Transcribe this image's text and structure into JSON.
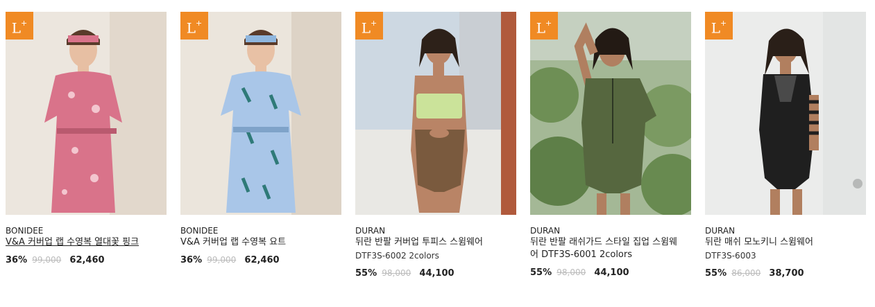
{
  "products": [
    {
      "badge": "L",
      "badge_sup": "+",
      "brand": "BONIDEE",
      "name": "V&A 커버업 랩 수영복 열대꽃 핑크",
      "code": "",
      "discount": "36%",
      "original_price": "99,000",
      "sale_price": "62,460",
      "outfit_color": "#d9738a",
      "bg_color": "#e8e1d8"
    },
    {
      "badge": "L",
      "badge_sup": "+",
      "brand": "BONIDEE",
      "name": "V&A 커버업 랩 수영복 요트",
      "code": "",
      "discount": "36%",
      "original_price": "99,000",
      "sale_price": "62,460",
      "outfit_color": "#8fb6de",
      "bg_color": "#e7e0d6"
    },
    {
      "badge": "L",
      "badge_sup": "+",
      "brand": "DURAN",
      "name": "뒤란 반팔 커버업 투피스 스윔웨어",
      "code": "DTF3S-6002 2colors",
      "discount": "55%",
      "original_price": "98,000",
      "sale_price": "44,100",
      "outfit_color": "#7a5a3e",
      "bg_color": "#cfd9e3"
    },
    {
      "badge": "L",
      "badge_sup": "+",
      "brand": "DURAN",
      "name": "뒤란 반팔 래쉬가드 스타일 집업 스윔웨어 DTF3S-6001 2colors",
      "code": "",
      "discount": "55%",
      "original_price": "98,000",
      "sale_price": "44,100",
      "outfit_color": "#56673f",
      "bg_color": "#8aa677"
    },
    {
      "badge": "L",
      "badge_sup": "+",
      "brand": "DURAN",
      "name": "뒤란 매쉬 모노키니 스윔웨어",
      "code": "DTF3S-6003",
      "discount": "55%",
      "original_price": "86,000",
      "sale_price": "38,700",
      "outfit_color": "#1f1f1f",
      "bg_color": "#ebeceb"
    }
  ]
}
